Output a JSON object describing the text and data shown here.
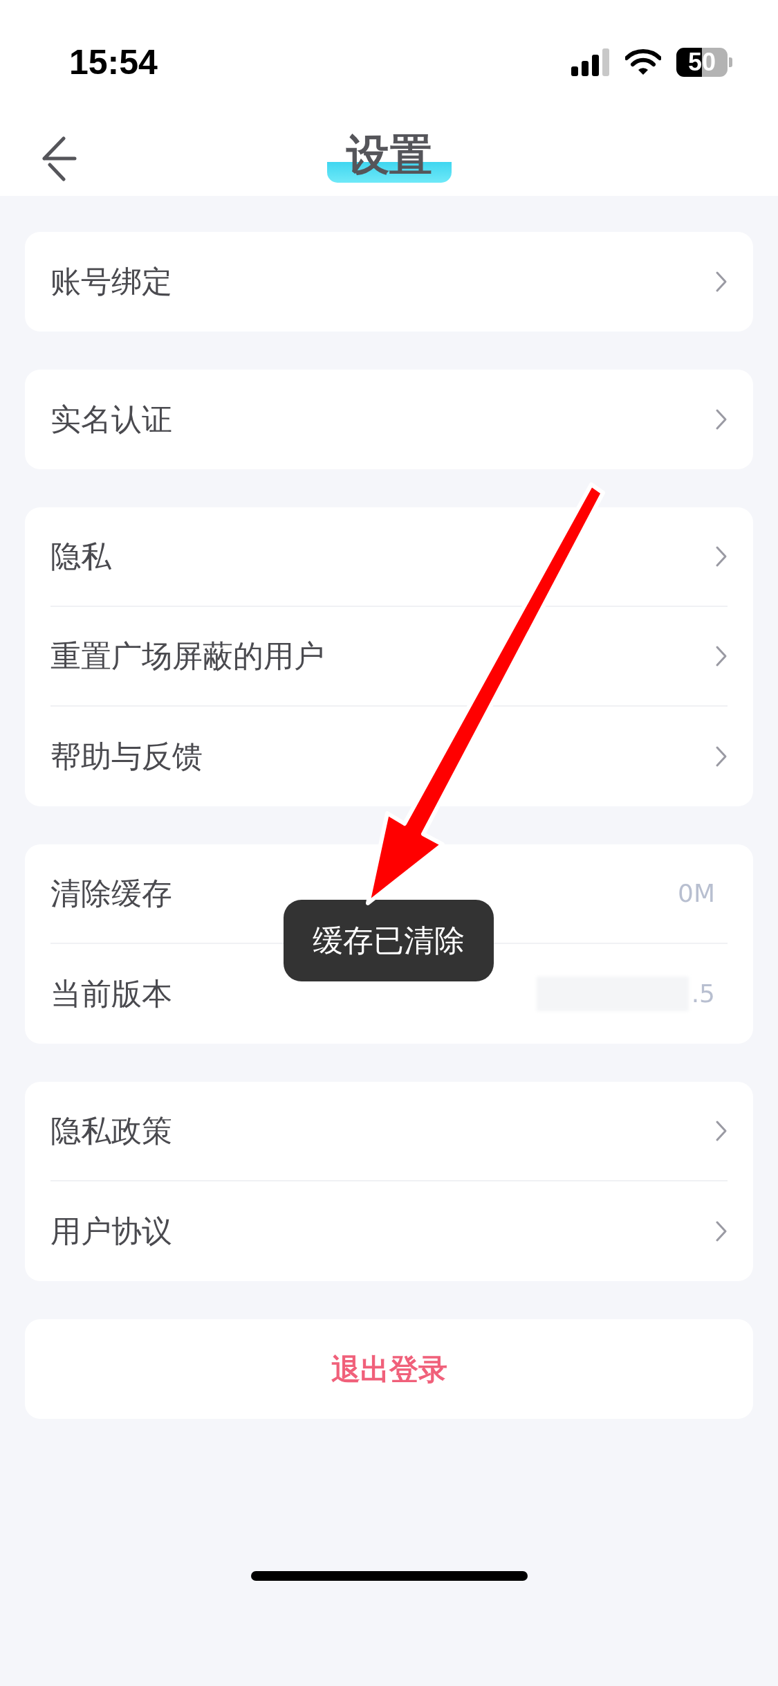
{
  "status_bar": {
    "time": "15:54",
    "battery": "50"
  },
  "header": {
    "title": "设置"
  },
  "groups": [
    {
      "items": [
        {
          "kind": "link",
          "label": "账号绑定"
        }
      ]
    },
    {
      "items": [
        {
          "kind": "link",
          "label": "实名认证"
        }
      ]
    },
    {
      "items": [
        {
          "kind": "link",
          "label": "隐私"
        },
        {
          "kind": "link",
          "label": "重置广场屏蔽的用户"
        },
        {
          "kind": "link",
          "label": "帮助与反馈"
        }
      ]
    },
    {
      "items": [
        {
          "kind": "value",
          "label": "清除缓存",
          "value": "0M"
        },
        {
          "kind": "blurred_value",
          "label": "当前版本",
          "value": ".5"
        }
      ]
    },
    {
      "items": [
        {
          "kind": "link",
          "label": "隐私政策"
        },
        {
          "kind": "link",
          "label": "用户协议"
        }
      ]
    }
  ],
  "logout": {
    "label": "退出登录"
  },
  "toast": {
    "text": "缓存已清除"
  }
}
